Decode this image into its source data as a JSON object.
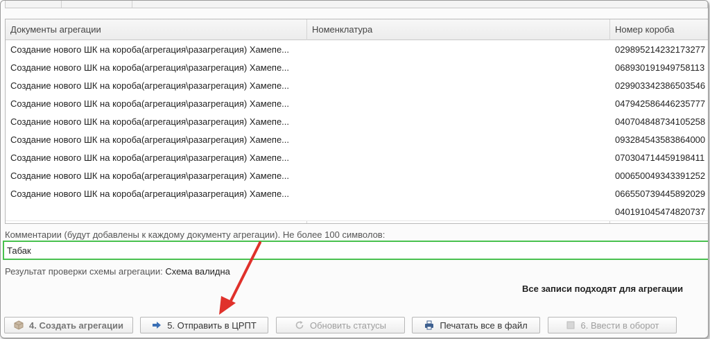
{
  "table": {
    "columns": [
      "Документы  агрегации",
      "Номенклатура",
      "Номер короба"
    ],
    "rows": [
      {
        "doc": "Создание нового ШК на короба(агрегация\\разагрегация) Хамепе...",
        "nom": "",
        "box": "029895214232173277"
      },
      {
        "doc": "Создание нового ШК на короба(агрегация\\разагрегация) Хамепе...",
        "nom": "",
        "box": "068930191949758113"
      },
      {
        "doc": "Создание нового ШК на короба(агрегация\\разагрегация) Хамепе...",
        "nom": "",
        "box": "029903342386503546"
      },
      {
        "doc": "Создание нового ШК на короба(агрегация\\разагрегация) Хамепе...",
        "nom": "",
        "box": "047942586446235777"
      },
      {
        "doc": "Создание нового ШК на короба(агрегация\\разагрегация) Хамепе...",
        "nom": "",
        "box": "040704848734105258"
      },
      {
        "doc": "Создание нового ШК на короба(агрегация\\разагрегация) Хамепе...",
        "nom": "",
        "box": "093284543583864000"
      },
      {
        "doc": "Создание нового ШК на короба(агрегация\\разагрегация) Хамепе...",
        "nom": "",
        "box": "070304714459198411"
      },
      {
        "doc": "Создание нового ШК на короба(агрегация\\разагрегация) Хамепе...",
        "nom": "",
        "box": "000650049343391252"
      },
      {
        "doc": "Создание нового ШК на короба(агрегация\\разагрегация) Хамепе...",
        "nom": "",
        "box": "066550739445892029"
      },
      {
        "doc": "",
        "nom": "",
        "box": "040191045474820737"
      }
    ]
  },
  "comment": {
    "label": "Комментарии (будут добавлены к каждому документу агрегации). Не более 100 символов:",
    "value": "Табак"
  },
  "check": {
    "label": "Результат проверки схемы агрегации:",
    "value": "Схема валидна"
  },
  "status_message": "Все записи подходят для агрегации",
  "buttons": {
    "create": "4. Создать агрегации",
    "send": "5. Отправить в ЦРПТ",
    "refresh": "Обновить статусы",
    "print": "Печатать все в файл",
    "circulate": "6. Ввести в оборот"
  },
  "colors": {
    "input_border": "#49c14f",
    "arrow": "#e0312b"
  }
}
